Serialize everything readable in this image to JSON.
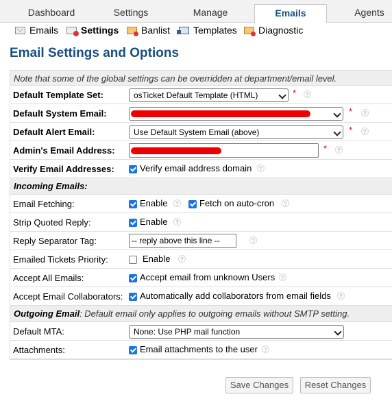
{
  "topnav": {
    "tabs": [
      {
        "label": "Dashboard"
      },
      {
        "label": "Settings"
      },
      {
        "label": "Manage"
      },
      {
        "label": "Emails"
      },
      {
        "label": "Agents"
      }
    ]
  },
  "subnav": {
    "items": [
      {
        "label": "Emails",
        "icon": "mail-icon"
      },
      {
        "label": "Settings",
        "icon": "email-settings-icon"
      },
      {
        "label": "Banlist",
        "icon": "banlist-icon"
      },
      {
        "label": "Templates",
        "icon": "templates-icon"
      },
      {
        "label": "Diagnostic",
        "icon": "diagnostic-icon"
      }
    ]
  },
  "page": {
    "title": "Email Settings and Options",
    "note": "Note that some of the global settings can be overridden at department/email level."
  },
  "fields": {
    "template_set": {
      "label": "Default Template Set:",
      "value": "osTicket Default Template (HTML)"
    },
    "system_email": {
      "label": "Default System Email:",
      "value": ""
    },
    "alert_email": {
      "label": "Default Alert Email:",
      "value": "Use Default System Email (above)"
    },
    "admin_email": {
      "label": "Admin's Email Address:",
      "value": ""
    },
    "verify_email": {
      "label": "Verify Email Addresses:",
      "option": "Verify email address domain"
    }
  },
  "incoming": {
    "title": "Incoming Emails:",
    "email_fetching": {
      "label": "Email Fetching:",
      "enable": "Enable",
      "autocron": "Fetch on auto-cron"
    },
    "strip_quoted": {
      "label": "Strip Quoted Reply:",
      "enable": "Enable"
    },
    "separator_tag": {
      "label": "Reply Separator Tag:",
      "value": "-- reply above this line --"
    },
    "priority": {
      "label": "Emailed Tickets Priority:",
      "enable": "Enable"
    },
    "accept_all": {
      "label": "Accept All Emails:",
      "option": "Accept email from unknown Users"
    },
    "collaborators": {
      "label": "Accept Email Collaborators:",
      "option": "Automatically add collaborators from email fields"
    }
  },
  "outgoing": {
    "title": "Outgoing Email",
    "desc": ": Default email only applies to outgoing emails without SMTP setting.",
    "default_mta": {
      "label": "Default MTA:",
      "value": "None: Use PHP mail function"
    },
    "attachments": {
      "label": "Attachments:",
      "option": "Email attachments to the user"
    }
  },
  "buttons": {
    "save": "Save Changes",
    "reset": "Reset Changes"
  },
  "colors": {
    "title_blue": "#184E81",
    "checkbox_blue": "#1a73e8",
    "required_red": "#e00"
  }
}
